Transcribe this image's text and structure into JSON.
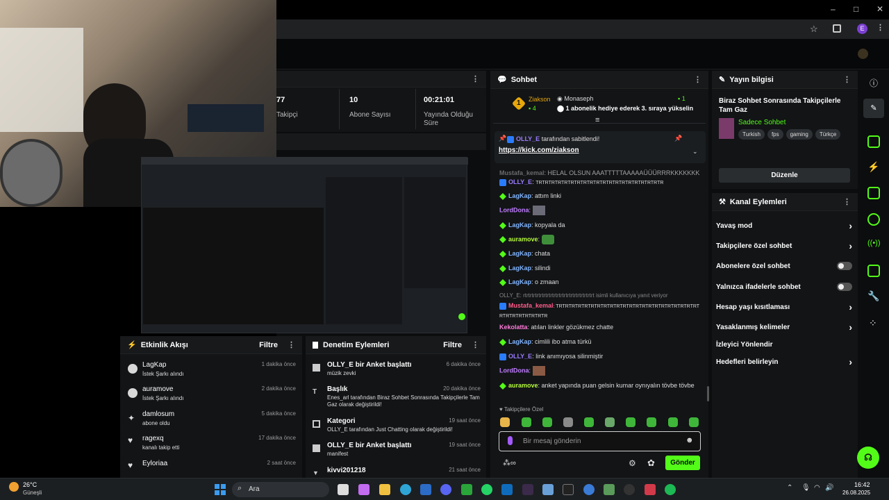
{
  "window": {
    "minimize": "–",
    "maximize": "□",
    "close": "✕"
  },
  "browser": {
    "profile_initial": "E"
  },
  "stats": [
    {
      "value": "77",
      "label": "Takipçi"
    },
    {
      "value": "10",
      "label": "Abone Sayısı"
    },
    {
      "value": "00:21:01",
      "label": "Yayında Olduğu Süre"
    }
  ],
  "chat": {
    "title": "Sohbet",
    "leader": {
      "rank": "1",
      "name": "Ziakson",
      "count": "4",
      "gifter": "Monaseph",
      "gift_count": "1",
      "gift_text": "1 abonelik hediye ederek 3. sıraya yükselin"
    },
    "pinned": {
      "user": "OLLY_E",
      "suffix": "tarafından sabitlendi!",
      "link": "https://kick.com/ziakson"
    },
    "messages": [
      {
        "user": "Mustafa_kemal",
        "text": "HELAL OLSUN AAATTTTTAAAAAÜÜÜRRRKKKKKKK",
        "color": "#8f8f8f",
        "badge": "none"
      },
      {
        "user": "OLLY_E",
        "text": "TRTRTRTRTRTRTRTRTRTRTRTRTRTRTRTRTRTRTRTR",
        "color": "#9a7cff",
        "badge": "kick"
      },
      {
        "user": "LagKap",
        "text": "attım linki",
        "color": "#7fb4ff",
        "badge": "sub"
      },
      {
        "user": "LordDona",
        "text": "",
        "color": "#c07cff",
        "badge": "none"
      },
      {
        "user": "LagKap",
        "text": "kopyala da",
        "color": "#7fb4ff",
        "badge": "sub"
      },
      {
        "user": "auramove",
        "text": "",
        "color": "#b8ff3c",
        "badge": "sub"
      },
      {
        "user": "LagKap",
        "text": "chata",
        "color": "#7fb4ff",
        "badge": "sub"
      },
      {
        "user": "LagKap",
        "text": "silindi",
        "color": "#7fb4ff",
        "badge": "sub"
      },
      {
        "user": "LagKap",
        "text": "o zmaan",
        "color": "#7fb4ff",
        "badge": "sub"
      }
    ],
    "reply_note": "OLLY_E: rtrtrtrtrtrtrtrtrtrtrtrtrtrtrtrtrtrtrtrtrt isimli kullanıcıya yanıt veriyor",
    "messages2": [
      {
        "user": "Mustafa_kemal",
        "text": "TRTRTRTRTRTRTRTRTRTRTRTRTRTRTRTRTRTRTRTRTRTRTRTRTRTRTRTRTRTR",
        "color": "#ff5c8a",
        "badge": "kick"
      },
      {
        "user": "Kekolatta",
        "text": "atılan linkler gözükmez chatte",
        "color": "#ff7ad9",
        "badge": "none"
      },
      {
        "user": "LagKap",
        "text": "cimlili ibo atma türkü",
        "color": "#7fb4ff",
        "badge": "sub"
      },
      {
        "user": "OLLY_E",
        "text": "link anımıyosa silinmiştir",
        "color": "#9a7cff",
        "badge": "kick"
      },
      {
        "user": "LordDona",
        "text": "",
        "color": "#c07cff",
        "badge": "none"
      },
      {
        "user": "auramove",
        "text": "anket yapında puan gelsin kumar oynıyalın tövbe tövbe",
        "color": "#b8ff3c",
        "badge": "sub"
      }
    ],
    "followers_only": "Takipçilere Özel",
    "input_placeholder": "Bir mesaj gönderin",
    "send": "Gönder"
  },
  "stream_info": {
    "title": "Yayın bilgisi",
    "stream_title": "Biraz Sohbet Sonrasında Takipçilerle Tam Gaz",
    "category": "Sadece Sohbet",
    "tags": [
      "Turkish",
      "fps",
      "gaming",
      "Türkçe"
    ],
    "edit": "Düzenle"
  },
  "channel_actions": {
    "title": "Kanal Eylemleri",
    "items": [
      {
        "label": "Yavaş mod",
        "control": "chevron"
      },
      {
        "label": "Takipçilere özel sohbet",
        "control": "chevron"
      },
      {
        "label": "Abonelere özel sohbet",
        "control": "toggle"
      },
      {
        "label": "Yalnızca ifadelerle sohbet",
        "control": "toggle"
      },
      {
        "label": "Hesap yaşı kısıtlaması",
        "control": "chevron"
      },
      {
        "label": "Yasaklanmış kelimeler",
        "control": "chevron"
      },
      {
        "label": "İzleyici Yönlendir",
        "control": "none"
      },
      {
        "label": "Hedefleri belirleyin",
        "control": "chevron"
      }
    ]
  },
  "activity": {
    "title": "Etkinlik Akışı",
    "filter": "Filtre",
    "items": [
      {
        "name": "LagKap",
        "sub": "İstek Şarkı alındı",
        "time": "1 dakika önce"
      },
      {
        "name": "auramove",
        "sub": "İstek Şarkı alındı",
        "time": "2 dakika önce"
      },
      {
        "name": "damlosum",
        "sub": "abone oldu",
        "time": "5 dakika önce"
      },
      {
        "name": "ragexq",
        "sub": "kanalı takip etti",
        "time": "17 dakika önce"
      },
      {
        "name": "Eyloriaa",
        "sub": "",
        "time": "2 saat önce"
      }
    ]
  },
  "moderation": {
    "title": "Denetim Eylemleri",
    "filter": "Filtre",
    "items": [
      {
        "name": "OLLY_E bir Anket başlattı",
        "sub": "müzik zevki",
        "time": "6 dakika önce"
      },
      {
        "name": "Başlık",
        "sub": "Enes_arl tarafından Biraz Sohbet Sonrasında Takipçilerle Tam Gaz olarak değiştirildi!",
        "time": "20 dakika önce"
      },
      {
        "name": "Kategori",
        "sub": "OLLY_E tarafından Just Chatting olarak değiştirildi!",
        "time": "19 saat önce"
      },
      {
        "name": "OLLY_E bir Anket başlattı",
        "sub": "manifest",
        "time": "19 saat önce"
      },
      {
        "name": "kivvi201218",
        "sub": "",
        "time": "21 saat önce"
      }
    ]
  },
  "taskbar": {
    "weather_temp": "26°C",
    "weather_desc": "Güneşli",
    "search": "Ara",
    "time": "16:42",
    "date": "26.08.2025"
  }
}
